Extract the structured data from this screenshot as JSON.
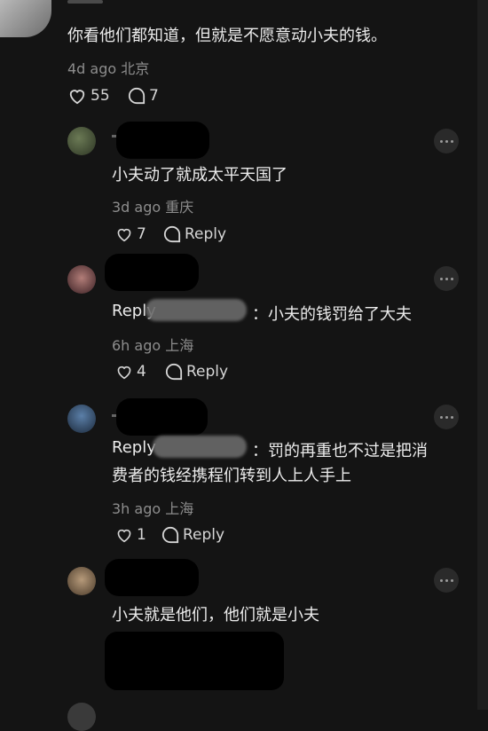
{
  "top_comment": {
    "text": "你看他们都知道，但就是不愿意动小夫的钱。",
    "time": "4d ago",
    "location": "北京",
    "likes": "55",
    "replies": "7"
  },
  "replies": [
    {
      "text": "小夫动了就成太平天国了",
      "time": "3d ago",
      "location": "重庆",
      "likes": "7",
      "reply_label": "Reply"
    },
    {
      "reply_prefix": "Reply",
      "text": "：小夫的钱罚给了大夫",
      "time": "6h ago",
      "location": "上海",
      "likes": "4",
      "reply_label": "Reply"
    },
    {
      "reply_prefix": "Reply",
      "text_line1": "：罚的再重也不过是把消",
      "text_line2": "费者的钱经携程们转到人上人手上",
      "time": "3h ago",
      "location": "上海",
      "likes": "1",
      "reply_label": "Reply"
    },
    {
      "text": "小夫就是他们，他们就是小夫"
    }
  ],
  "colors": {
    "background": "#141414",
    "text": "#ececec",
    "meta": "#8d8d8d",
    "redaction": "#000000"
  },
  "icons": [
    "heart-outline-icon",
    "comment-bubble-icon",
    "more-dots-icon"
  ]
}
